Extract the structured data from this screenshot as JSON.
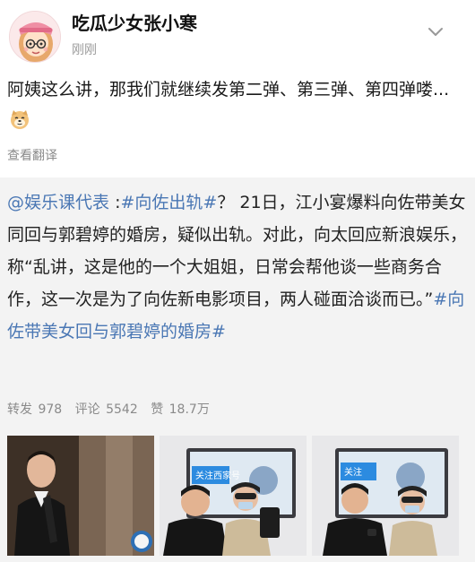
{
  "user": {
    "name": "吃瓜少女张小寒",
    "time": "刚刚"
  },
  "post": {
    "text": "阿姨这么讲，那我们就继续发第二弹、第三弹、第四弹喽...",
    "emoji": "doge-emoji",
    "translate_label": "查看翻译"
  },
  "repost": {
    "mention": "@娱乐课代表",
    "hashtag1": "#向佐出轨#",
    "body1": "？ 21日，江小宴爆料向佐带美女同回与郭碧婷的婚房，疑似出轨。对此，向太回应新浪娱乐，称“乱讲，这是他的一个大姐姐，日常会帮他谈一些商务合作，这一次是为了向佐新电影项目，两人碰面洽谈而已。”",
    "hashtag2": "#向佐带美女回与郭碧婷的婚房#",
    "stats": {
      "repost_label": "转发",
      "repost_count": "978",
      "comment_label": "评论",
      "comment_count": "5542",
      "like_label": "赞",
      "like_count": "18.7万"
    },
    "image_texts": {
      "sign_follow": "关注",
      "sign_follow_full": "关注西家号"
    }
  },
  "colors": {
    "link": "#4a77b4",
    "repost_bg": "#f3f3f3",
    "muted": "#8a8a8a"
  }
}
